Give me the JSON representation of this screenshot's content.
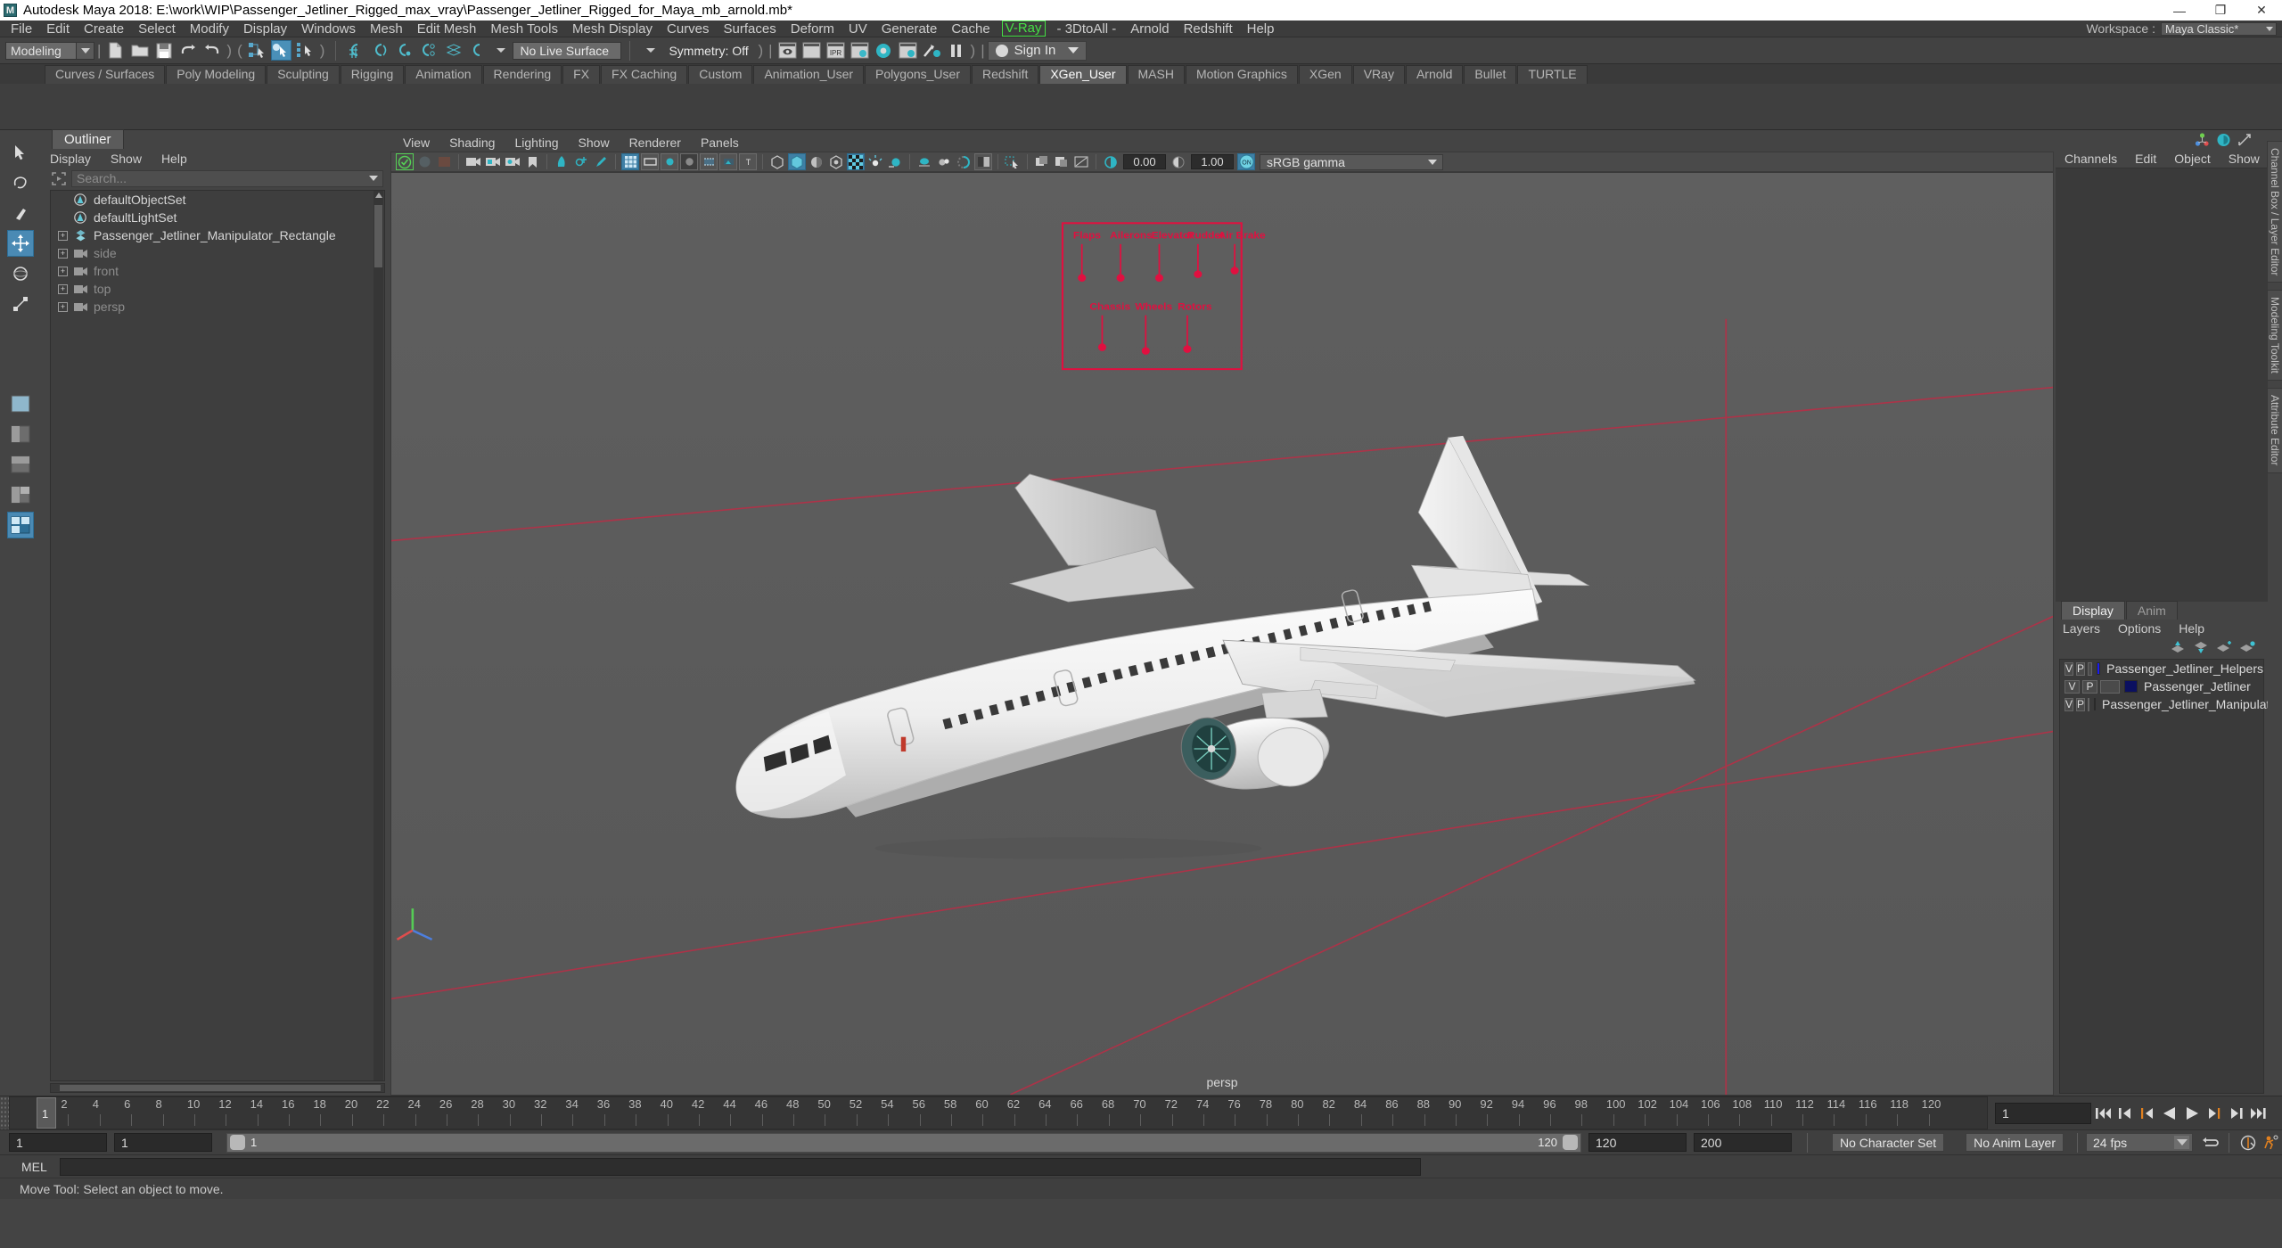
{
  "window": {
    "title": "Autodesk Maya 2018: E:\\work\\WIP\\Passenger_Jetliner_Rigged_max_vray\\Passenger_Jetliner_Rigged_for_Maya_mb_arnold.mb*",
    "logo": "M",
    "minimize": "—",
    "maximize": "❐",
    "close": "✕"
  },
  "menubar": {
    "items": [
      "File",
      "Edit",
      "Create",
      "Select",
      "Modify",
      "Display",
      "Windows",
      "Mesh",
      "Edit Mesh",
      "Mesh Tools",
      "Mesh Display",
      "Curves",
      "Surfaces",
      "Deform",
      "UV",
      "Generate",
      "Cache"
    ],
    "vray": "V-Ray",
    "items_after": [
      "- 3DtoAll -",
      "Arnold",
      "Redshift",
      "Help"
    ],
    "workspace_label": "Workspace :",
    "workspace_value": "Maya Classic*"
  },
  "statusbar": {
    "menu_set": "Modeling",
    "live_surface": "No Live Surface",
    "symmetry": "Symmetry: Off",
    "sign_in": "Sign In",
    "icons": [
      "new-scene-icon",
      "open-scene-icon",
      "save-scene-icon",
      "undo-icon",
      "redo-icon",
      "select-hierarchy-icon",
      "select-object-icon",
      "select-component-icon",
      "snap-grid-icon",
      "snap-curve-icon",
      "snap-point-icon",
      "snap-projected-center-icon",
      "snap-view-plane-icon",
      "make-live-icon",
      "render-current-frame-icon",
      "render-sequence-icon",
      "ipr-render-icon",
      "render-settings-icon",
      "hypershade-icon",
      "render-view-icon",
      "render-setup-icon",
      "pause-render-icon"
    ]
  },
  "shelf": {
    "tabs": [
      "Curves / Surfaces",
      "Poly Modeling",
      "Sculpting",
      "Rigging",
      "Animation",
      "Rendering",
      "FX",
      "FX Caching",
      "Custom",
      "Animation_User",
      "Polygons_User",
      "Redshift",
      "XGen_User",
      "MASH",
      "Motion Graphics",
      "XGen",
      "VRay",
      "Arnold",
      "Bullet",
      "TURTLE"
    ],
    "active_tab": "XGen_User"
  },
  "outliner": {
    "tab": "Outliner",
    "menus": [
      "Display",
      "Show",
      "Help"
    ],
    "search_placeholder": "Search...",
    "items": [
      {
        "label": "persp",
        "icon": "camera-icon",
        "dim": true,
        "expandable": true
      },
      {
        "label": "top",
        "icon": "camera-icon",
        "dim": true,
        "expandable": true
      },
      {
        "label": "front",
        "icon": "camera-icon",
        "dim": true,
        "expandable": true
      },
      {
        "label": "side",
        "icon": "camera-icon",
        "dim": true,
        "expandable": true
      },
      {
        "label": "Passenger_Jetliner_Manipulator_Rectangle",
        "icon": "transform-icon",
        "dim": false,
        "expandable": true
      },
      {
        "label": "defaultLightSet",
        "icon": "set-icon",
        "dim": false,
        "expandable": false
      },
      {
        "label": "defaultObjectSet",
        "icon": "set-icon",
        "dim": false,
        "expandable": false
      }
    ]
  },
  "viewport": {
    "menus": [
      "View",
      "Shading",
      "Lighting",
      "Show",
      "Renderer",
      "Panels"
    ],
    "exposure": "0.00",
    "gamma_value": "1.00",
    "color_management": "sRGB gamma",
    "camera_label": "persp",
    "manipulator_labels_top": [
      "Flaps",
      "Ailerons",
      "Elevator",
      "Rudder",
      "Air Brake"
    ],
    "manipulator_labels_bottom": [
      "Chassis",
      "Wheels",
      "Rotors"
    ],
    "manipulator_color": "#e01040",
    "grid_color": "#b03040"
  },
  "channelbox": {
    "menus": [
      "Channels",
      "Edit",
      "Object",
      "Show"
    ],
    "icons": [
      "channel-box-icon",
      "attribute-editor-icon",
      "modeling-toolkit-icon"
    ]
  },
  "layers": {
    "tabs": [
      "Display",
      "Anim"
    ],
    "active_tab": "Display",
    "menus": [
      "Layers",
      "Options",
      "Help"
    ],
    "buttons": [
      "move-layer-up-icon",
      "move-layer-down-icon",
      "new-layer-icon",
      "new-layer-from-selected-icon"
    ],
    "rows": [
      {
        "v": "V",
        "p": "P",
        "color": "#1b1bf0",
        "name": "Passenger_Jetliner_Helpers"
      },
      {
        "v": "V",
        "p": "P",
        "color": "#0b1060",
        "name": "Passenger_Jetliner"
      },
      {
        "v": "V",
        "p": "P",
        "color": "#c8143c",
        "name": "Passenger_Jetliner_Manipulator"
      }
    ]
  },
  "right_tabs": [
    "Channel Box / Layer Editor",
    "Modeling Toolkit",
    "Attribute Editor"
  ],
  "timeline": {
    "ticks": [
      "2",
      "4",
      "6",
      "8",
      "10",
      "12",
      "14",
      "16",
      "18",
      "20",
      "22",
      "24",
      "26",
      "28",
      "30",
      "32",
      "34",
      "36",
      "38",
      "40",
      "42",
      "44",
      "46",
      "48",
      "50",
      "52",
      "54",
      "56",
      "58",
      "60",
      "62",
      "64",
      "66",
      "68",
      "70",
      "72",
      "74",
      "76",
      "78",
      "80",
      "82",
      "84",
      "86",
      "88",
      "90",
      "92",
      "94",
      "96",
      "98",
      "100",
      "102",
      "104",
      "106",
      "108",
      "110",
      "112",
      "114",
      "116",
      "118",
      "120"
    ],
    "current_frame_marker": "1",
    "current_frame_field": "1",
    "playback_buttons": [
      "go-to-start-icon",
      "step-back-keyframe-icon",
      "step-back-frame-icon",
      "play-backwards-icon",
      "play-forwards-icon",
      "step-forward-frame-icon",
      "step-forward-keyframe-icon",
      "go-to-end-icon"
    ]
  },
  "rangeslider": {
    "anim_start": "1",
    "range_start": "1",
    "slider_left_value": "1",
    "slider_right_value": "120",
    "range_end": "120",
    "anim_end": "200",
    "character_set": "No Character Set",
    "anim_layer": "No Anim Layer",
    "fps": "24 fps",
    "icons": [
      "auto-keyframe-icon",
      "animation-preferences-icon",
      "playback-loop-icon"
    ]
  },
  "command": {
    "language": "MEL",
    "input_value": ""
  },
  "status": {
    "help_text": "Move Tool: Select an object to move."
  }
}
